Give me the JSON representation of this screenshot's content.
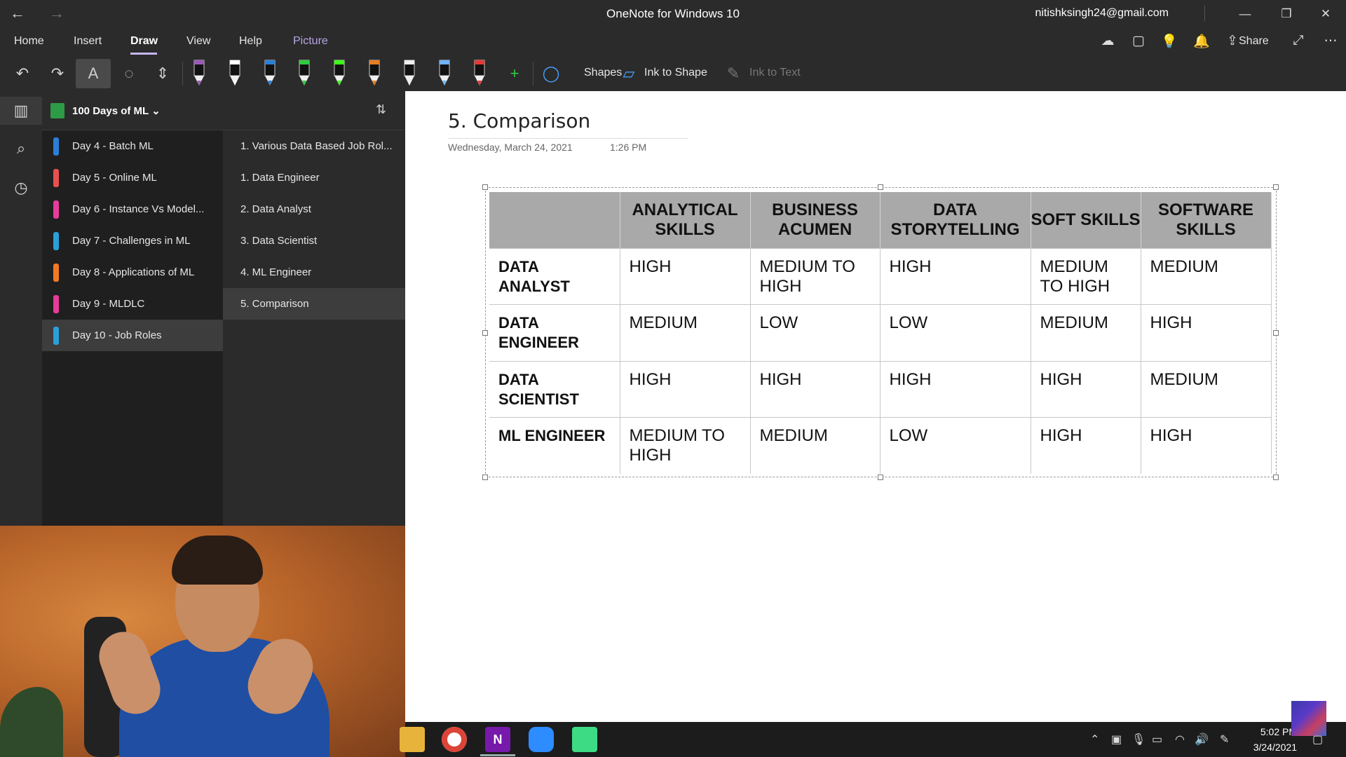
{
  "window": {
    "title": "OneNote for Windows 10",
    "account": "nitishksingh24@gmail.com",
    "back_glyph": "←",
    "forward_glyph": "→",
    "controls": [
      "—",
      "❐",
      "✕"
    ]
  },
  "menu": {
    "items": [
      "Home",
      "Insert",
      "Draw",
      "View",
      "Help",
      "Picture"
    ],
    "active": "Draw",
    "share_label": "Share"
  },
  "toolbar": {
    "shapes_label": "Shapes",
    "ink_to_shape_label": "Ink to Shape",
    "ink_to_text_label": "Ink to Text",
    "pen_colors": [
      "#9b59b6",
      "#ffffff",
      "#2a7fd8",
      "#2ecc40",
      "#39ff14",
      "#e67e22",
      "#eeeeee",
      "#6fb3ff",
      "#e53935"
    ],
    "add_pen_glyph": "+"
  },
  "notebook": {
    "name": "100 Days of ML",
    "sections": [
      {
        "label": "Day 4 - Batch ML",
        "color": "#2a7fd8"
      },
      {
        "label": "Day 5 - Online ML",
        "color": "#e85050"
      },
      {
        "label": "Day 6 - Instance Vs Model...",
        "color": "#e63c9a"
      },
      {
        "label": "Day 7 - Challenges in ML",
        "color": "#2a9fd8"
      },
      {
        "label": "Day 8 - Applications of ML",
        "color": "#f07a24"
      },
      {
        "label": "Day 9 - MLDLC",
        "color": "#e63c9a"
      },
      {
        "label": "Day 10 - Job Roles",
        "color": "#2a9fd8"
      }
    ],
    "selected_section": "Day 10 - Job Roles",
    "pages": [
      "1. Various Data Based Job Rol...",
      "1. Data Engineer",
      "2. Data Analyst",
      "3. Data Scientist",
      "4. ML Engineer",
      "5. Comparison"
    ],
    "selected_page": "5. Comparison"
  },
  "page": {
    "title": "5. Comparison",
    "date": "Wednesday, March 24, 2021",
    "time": "1:26 PM"
  },
  "table": {
    "headers": [
      "",
      "ANALYTICAL SKILLS",
      "BUSINESS ACUMEN",
      "DATA STORYTELLING",
      "SOFT SKILLS",
      "SOFTWARE SKILLS"
    ],
    "rows": [
      [
        "DATA ANALYST",
        "HIGH",
        "MEDIUM TO HIGH",
        "HIGH",
        "MEDIUM TO HIGH",
        "MEDIUM"
      ],
      [
        "DATA ENGINEER",
        "MEDIUM",
        "LOW",
        "LOW",
        "MEDIUM",
        "HIGH"
      ],
      [
        "DATA SCIENTIST",
        "HIGH",
        "HIGH",
        "HIGH",
        "HIGH",
        "MEDIUM"
      ],
      [
        "ML ENGINEER",
        "MEDIUM TO HIGH",
        "MEDIUM",
        "LOW",
        "HIGH",
        "HIGH"
      ]
    ]
  },
  "taskbar": {
    "apps": [
      "file-explorer",
      "chrome",
      "onenote",
      "zoom",
      "android-studio"
    ],
    "onenote_glyph": "N",
    "time": "5:02 PM",
    "date": "3/24/2021"
  }
}
